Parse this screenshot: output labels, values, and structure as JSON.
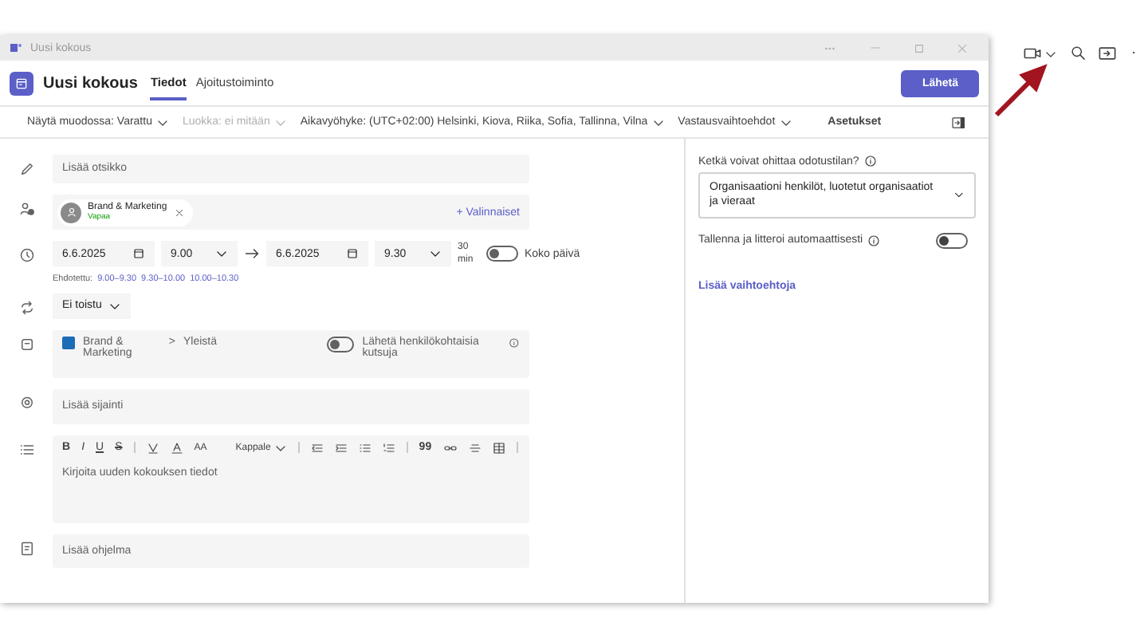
{
  "window": {
    "title": "Uusi kokous"
  },
  "header": {
    "title": "Uusi kokous",
    "tabs": [
      {
        "label": "Tiedot",
        "selected": true
      },
      {
        "label": "Ajoitustoiminto",
        "selected": false
      }
    ],
    "send_button": "Lähetä"
  },
  "options_bar": [
    {
      "label": "Näytä muodossa: Varattu",
      "disabled": false
    },
    {
      "label": "Luokka: ei mitään",
      "disabled": true
    },
    {
      "label": "Aikavyöhyke: (UTC+02:00) Helsinki, Kiova, Riika, Sofia, Tallinna, Vilna",
      "disabled": false
    },
    {
      "label": "Vastausvaihtoehdot",
      "disabled": false
    }
  ],
  "form": {
    "title_placeholder": "Lisää otsikko",
    "attendee": {
      "name": "Brand & Marketing",
      "status": "Vapaa"
    },
    "optional_link": "+ Valinnaiset",
    "start_date": "6.6.2025",
    "start_time": "9.00",
    "end_date": "6.6.2025",
    "end_time": "9.30",
    "duration": "30 min",
    "all_day": {
      "label": "Koko päivä",
      "on": false
    },
    "suggested_label": "Ehdotettu:",
    "suggestions": [
      "9.00–9.30",
      "9.30–10.00",
      "10.00–10.30"
    ],
    "repeat": "Ei toistu",
    "channel": {
      "team": "Brand & Marketing",
      "separator": ">",
      "name": "Yleistä"
    },
    "personal_invites": {
      "label": "Lähetä henkilökohtaisia kutsuja",
      "on": false
    },
    "location_placeholder": "Lisää sijainti",
    "format_buttons": [
      {
        "label": "B",
        "kind": "bold"
      },
      {
        "label": "I",
        "kind": "italic"
      },
      {
        "label": "U",
        "kind": "underline"
      },
      {
        "label": "S",
        "kind": "strike"
      }
    ],
    "font_size_button": "AA",
    "paragraph_style": "Kappale",
    "quote_button": "99",
    "details_placeholder": "Kirjoita uuden kokouksen tiedot",
    "agenda_placeholder": "Lisää ohjelma"
  },
  "settings": {
    "title": "Asetukset",
    "lobby_label": "Ketkä voivat ohittaa odotustilan?",
    "lobby_value": "Organisaationi henkilöt, luotetut organisaatiot ja vieraat",
    "auto_record": {
      "label": "Tallenna ja litteroi automaattisesti",
      "on": false
    },
    "more_link": "Lisää vaihtoehtoja"
  }
}
